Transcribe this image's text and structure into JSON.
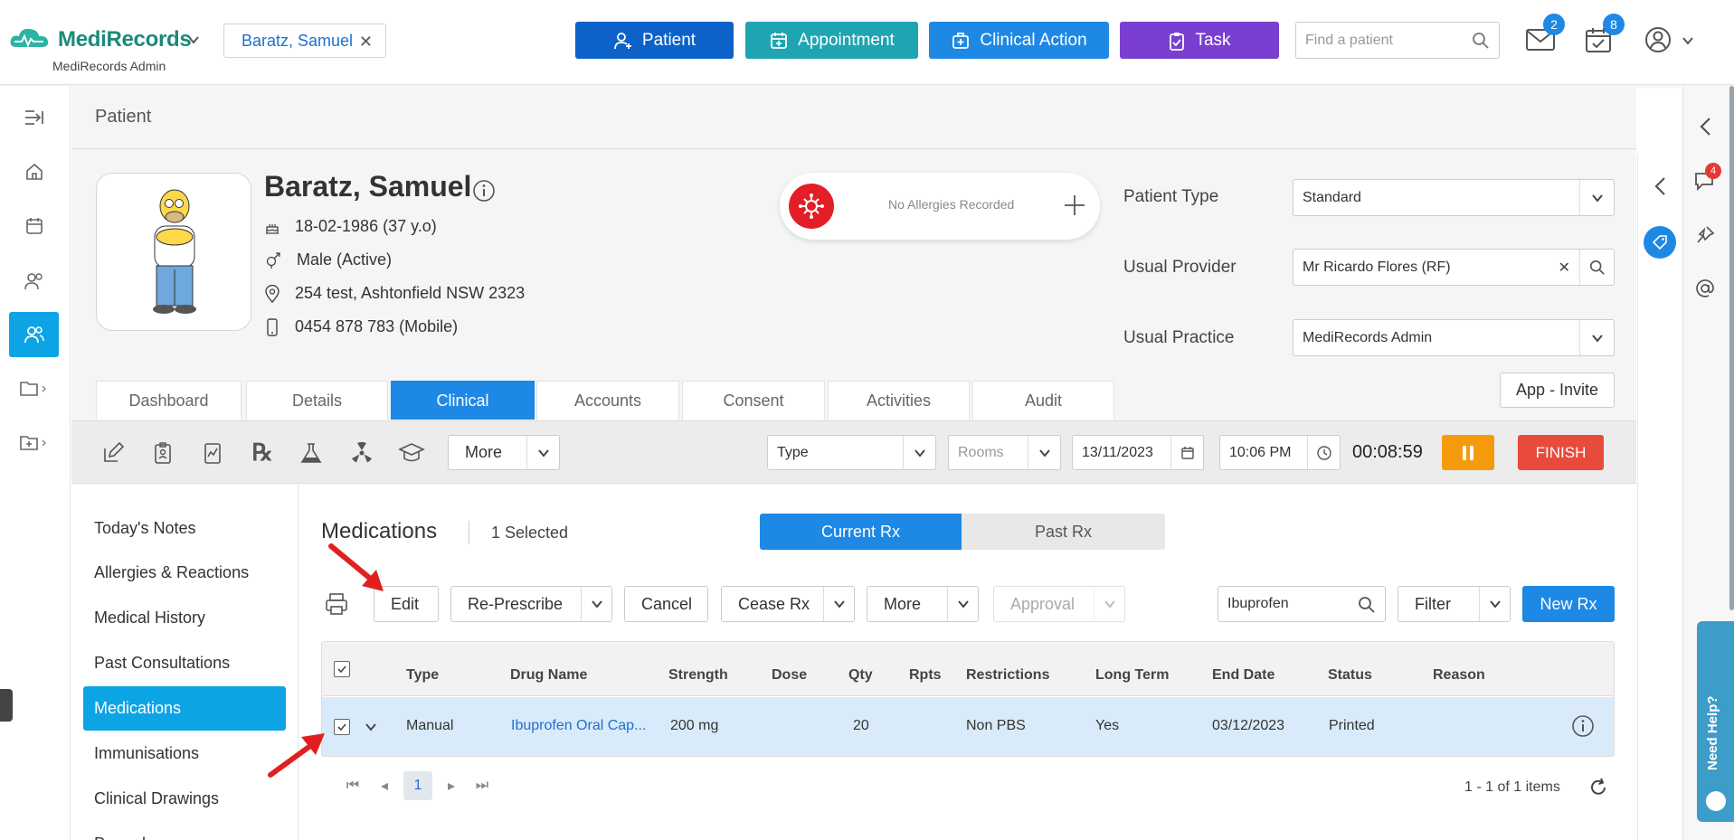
{
  "header": {
    "app_name": "MediRecords",
    "app_sub": "MediRecords Admin",
    "patient_chip": "Baratz, Samuel",
    "buttons": {
      "patient": "Patient",
      "appointment": "Appointment",
      "clinical_action": "Clinical Action",
      "task": "Task"
    },
    "search_placeholder": "Find a patient",
    "mail_badge": "2",
    "tasks_badge": "8",
    "colors": {
      "patient": "#0d62c9",
      "appointment": "#1fa5b1",
      "clinical_action": "#1e88e5",
      "task": "#7a3fd1"
    }
  },
  "right_panel": {
    "chat_badge": "4",
    "help_label": "Need Help?"
  },
  "patient": {
    "section_title": "Patient",
    "name": "Baratz, Samuel",
    "dob": "18-02-1986 (37 y.o)",
    "gender": "Male (Active)",
    "address": "254 test, Ashtonfield NSW 2323",
    "phone": "0454 878 783 (Mobile)",
    "allergies": "No Allergies Recorded",
    "fields": {
      "type_label": "Patient Type",
      "type_value": "Standard",
      "provider_label": "Usual Provider",
      "provider_value": "Mr Ricardo Flores (RF)",
      "practice_label": "Usual Practice",
      "practice_value": "MediRecords Admin"
    },
    "tabs": [
      "Dashboard",
      "Details",
      "Clinical",
      "Accounts",
      "Consent",
      "Activities",
      "Audit"
    ],
    "app_invite": "App - Invite"
  },
  "toolbar": {
    "more": "More",
    "type_placeholder": "Type",
    "rooms_placeholder": "Rooms",
    "date": "13/11/2023",
    "time": "10:06 PM",
    "timer": "00:08:59",
    "finish": "FINISH"
  },
  "clinical_nav": [
    "Today's Notes",
    "Allergies & Reactions",
    "Medical History",
    "Past Consultations",
    "Medications",
    "Immunisations",
    "Clinical Drawings",
    "Procedures"
  ],
  "medications": {
    "title": "Medications",
    "selected": "1 Selected",
    "seg_current": "Current Rx",
    "seg_past": "Past Rx",
    "actions": {
      "edit": "Edit",
      "represcribe": "Re-Prescribe",
      "cancel": "Cancel",
      "cease": "Cease Rx",
      "more": "More",
      "approval": "Approval",
      "filter": "Filter",
      "new_rx": "New Rx"
    },
    "search_value": "Ibuprofen",
    "columns": [
      "Type",
      "Drug Name",
      "Strength",
      "Dose",
      "Qty",
      "Rpts",
      "Restrictions",
      "Long Term",
      "End Date",
      "Status",
      "Reason"
    ],
    "rows": [
      {
        "type": "Manual",
        "drug": "Ibuprofen Oral Cap...",
        "strength": "200 mg",
        "dose": "",
        "qty": "20",
        "rpts": "",
        "restrictions": "Non PBS",
        "long_term": "Yes",
        "end_date": "03/12/2023",
        "status": "Printed",
        "reason": ""
      }
    ],
    "page": "1",
    "items_summary": "1 - 1 of 1 items"
  }
}
